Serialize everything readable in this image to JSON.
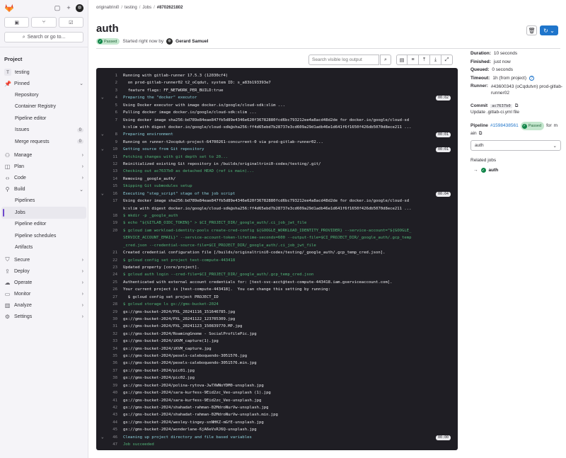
{
  "sidebar": {
    "search_label": "Search or go to...",
    "section_label": "Project",
    "project": {
      "initial": "T",
      "name": "testing"
    },
    "pinned_label": "Pinned",
    "pinned_items": [
      {
        "label": "Repository"
      },
      {
        "label": "Container Registry"
      },
      {
        "label": "Pipeline editor"
      },
      {
        "label": "Issues",
        "count": "0"
      },
      {
        "label": "Merge requests",
        "count": "0"
      }
    ],
    "groups_top": [
      {
        "label": "Manage",
        "icon": "users-icon"
      },
      {
        "label": "Plan",
        "icon": "plan-icon"
      },
      {
        "label": "Code",
        "icon": "code-icon"
      }
    ],
    "build_label": "Build",
    "build_items": [
      {
        "label": "Pipelines"
      },
      {
        "label": "Jobs",
        "active": true
      },
      {
        "label": "Pipeline editor"
      },
      {
        "label": "Pipeline schedules"
      },
      {
        "label": "Artifacts"
      }
    ],
    "groups_bottom": [
      {
        "label": "Secure",
        "icon": "shield-icon"
      },
      {
        "label": "Deploy",
        "icon": "deploy-icon"
      },
      {
        "label": "Operate",
        "icon": "operate-icon"
      },
      {
        "label": "Monitor",
        "icon": "monitor-icon"
      },
      {
        "label": "Analyze",
        "icon": "chart-icon"
      },
      {
        "label": "Settings",
        "icon": "gear-icon"
      }
    ]
  },
  "breadcrumb": [
    "originaltrini0",
    "testing",
    "Jobs",
    "#8702621802"
  ],
  "page": {
    "title": "auth",
    "status": "Passed",
    "started_text": "Started right now by",
    "user": "Gerard Samuel"
  },
  "log_toolbar": {
    "search_placeholder": "Search visible log output"
  },
  "log": [
    {
      "n": "1",
      "text": "Running with gitlab-runner 17.5.3 (12030cf4)",
      "c": "white"
    },
    {
      "n": "2",
      "text": "  on prod-gitlab-runner02 t2_oCqdut, system ID: s_a83b193393e7",
      "c": "white"
    },
    {
      "n": "3",
      "text": "  feature flags: FF_NETWORK_PER_BUILD:true",
      "c": "white"
    },
    {
      "n": "4",
      "text": "Preparing the \"docker\" executor",
      "c": "cyan",
      "caret": true,
      "dur": "00:02"
    },
    {
      "n": "5",
      "text": "Using Docker executor with image docker.io/google/cloud-sdk:slim ...",
      "c": "white"
    },
    {
      "n": "6",
      "text": "Pulling docker image docker.io/google/cloud-sdk:slim ...",
      "c": "white"
    },
    {
      "n": "7",
      "text": "Using docker image sha256:bd789e84eae847fb5d89e4346e620f36782880fcd6bc793212ee4a8acd48d2de for docker.io/google/cloud-sd",
      "c": "white"
    },
    {
      "n": "",
      "text": "k:slim with digest docker.io/google/cloud-sdk@sha256:ff4d65ebd7b28737e3cd609a29d1adb46e1d641f6f1650f426db5070d8ece211 ...",
      "c": "white"
    },
    {
      "n": "8",
      "text": "Preparing environment",
      "c": "cyan",
      "caret": true,
      "dur": "00:01"
    },
    {
      "n": "9",
      "text": "Running on runner-t2ocqdut-project-64700261-concurrent-0 via prod-gitlab-runner02...",
      "c": "white"
    },
    {
      "n": "10",
      "text": "Getting source from Git repository",
      "c": "cyan",
      "caret": true,
      "dur": "00:01"
    },
    {
      "n": "11",
      "text": "Fetching changes with git depth set to 20...",
      "c": "green"
    },
    {
      "n": "12",
      "text": "Reinitialized existing Git repository in /builds/originaltrini0-codes/testing/.git/",
      "c": "white"
    },
    {
      "n": "13",
      "text": "Checking out ac7637b0 as detached HEAD (ref is main)...",
      "c": "green"
    },
    {
      "n": "14",
      "text": "Removing _google_auth/",
      "c": "white"
    },
    {
      "n": "15",
      "text": "Skipping Git submodules setup",
      "c": "green"
    },
    {
      "n": "16",
      "text": "Executing \"step_script\" stage of the job script",
      "c": "cyan",
      "caret": true,
      "dur": "00:04"
    },
    {
      "n": "17",
      "text": "Using docker image sha256:bd789e84eae847fb5d89e4346e620f36782880fcd6bc793212ee4a8acd48d2de for docker.io/google/cloud-sd",
      "c": "white"
    },
    {
      "n": "",
      "text": "k:slim with digest docker.io/google/cloud-sdk@sha256:ff4d65ebd7b28737e3cd609a29d1adb46e1d641f6f1650f426db5070d8ece211 ...",
      "c": "white"
    },
    {
      "n": "18",
      "text": "$ mkdir -p _google_auth",
      "c": "green"
    },
    {
      "n": "19",
      "text": "$ echo \"${GITLAB_OIDC_TOKEN}\" > $CI_PROJECT_DIR/_google_auth/.ci_job_jwt_file",
      "c": "green"
    },
    {
      "n": "20",
      "text": "$ gcloud iam workload-identity-pools create-cred-config ${GOOGLE_WORKLOAD_IDENTITY_PROVIDER} --service-account=\"${GOOGLE_",
      "c": "green"
    },
    {
      "n": "",
      "text": "SERVICE_ACCOUNT_EMAIL}\" --service-account-token-lifetime-seconds=600 --output-file=$CI_PROJECT_DIR/_google_auth/.gcp_temp",
      "c": "green"
    },
    {
      "n": "",
      "text": "_cred.json --credential-source-file=$CI_PROJECT_DIR/_google_auth/.ci_job_jwt_file",
      "c": "green"
    },
    {
      "n": "21",
      "text": "Created credential configuration file [/builds/originaltrini0-codes/testing/_google_auth/.gcp_temp_cred.json].",
      "c": "white"
    },
    {
      "n": "22",
      "text": "$ gcloud config set project test-compute-443418",
      "c": "green"
    },
    {
      "n": "23",
      "text": "Updated property [core/project].",
      "c": "white"
    },
    {
      "n": "24",
      "text": "$ gcloud auth login --cred-file=$CI_PROJECT_DIR/_google_auth/.gcp_temp_cred.json",
      "c": "green"
    },
    {
      "n": "25",
      "text": "Authenticated with external account credentials for: [test-svc-acct@test-compute-443418.iam.gserviceaccount.com].",
      "c": "white"
    },
    {
      "n": "26",
      "text": "Your current project is [test-compute-443418].  You can change this setting by running:",
      "c": "white"
    },
    {
      "n": "27",
      "text": "  $ gcloud config set project PROJECT_ID",
      "c": "white"
    },
    {
      "n": "28",
      "text": "$ gcloud storage ls gs://gms-bucket-2024",
      "c": "green"
    },
    {
      "n": "29",
      "text": "gs://gms-bucket-2024/PXL_20241116_151646785.jpg",
      "c": "white"
    },
    {
      "n": "30",
      "text": "gs://gms-bucket-2024/PXL_20241122_123705309.jpg",
      "c": "white"
    },
    {
      "n": "31",
      "text": "gs://gms-bucket-2024/PXL_20241123_150839770.MP.jpg",
      "c": "white"
    },
    {
      "n": "32",
      "text": "gs://gms-bucket-2024/RoamingGnome - SocialProfilePic.jpg",
      "c": "white"
    },
    {
      "n": "33",
      "text": "gs://gms-bucket-2024/iKVM_capture(1).jpg",
      "c": "white"
    },
    {
      "n": "34",
      "text": "gs://gms-bucket-2024/iKVM_capture.jpg",
      "c": "white"
    },
    {
      "n": "35",
      "text": "gs://gms-bucket-2024/pexels-caleboquendo-3051576.jpg",
      "c": "white"
    },
    {
      "n": "36",
      "text": "gs://gms-bucket-2024/pexels-caleboquendo-3051576.min.jpg",
      "c": "white"
    },
    {
      "n": "37",
      "text": "gs://gms-bucket-2024/pic01.jpg",
      "c": "white"
    },
    {
      "n": "38",
      "text": "gs://gms-bucket-2024/pic02.jpg",
      "c": "white"
    },
    {
      "n": "39",
      "text": "gs://gms-bucket-2024/polina-rytova-Jw7XWNoYDM0-unsplash.jpg",
      "c": "white"
    },
    {
      "n": "40",
      "text": "gs://gms-bucket-2024/sara-kurfess-9Eid2zc_Veo-unsplash (1).jpg",
      "c": "white"
    },
    {
      "n": "41",
      "text": "gs://gms-bucket-2024/sara-kurfess-9Eid2zc_Veo-unsplash.jpg",
      "c": "white"
    },
    {
      "n": "42",
      "text": "gs://gms-bucket-2024/shahadat-rahman-02MdroNurVw-unsplash.jpg",
      "c": "white"
    },
    {
      "n": "43",
      "text": "gs://gms-bucket-2024/shahadat-rahman-02MdroNurVw-unsplash.min.jpg",
      "c": "white"
    },
    {
      "n": "44",
      "text": "gs://gms-bucket-2024/wesley-tingey-snNHKZ-mGfE-unsplash.jpg",
      "c": "white"
    },
    {
      "n": "45",
      "text": "gs://gms-bucket-2024/wonderlane-6jA6eVsRJ6Q-unsplash.jpg",
      "c": "white"
    },
    {
      "n": "46",
      "text": "Cleaning up project directory and file based variables",
      "c": "cyan",
      "caret": true,
      "dur": "00:00"
    },
    {
      "n": "47",
      "text": "Job succeeded",
      "c": "green"
    }
  ],
  "details": {
    "duration_label": "Duration:",
    "duration": "10 seconds",
    "finished_label": "Finished:",
    "finished": "just now",
    "queued_label": "Queued:",
    "queued": "0 seconds",
    "timeout_label": "Timeout:",
    "timeout": "1h (from project)",
    "runner_label": "Runner:",
    "runner": "#43600343 (oCqdutvn) prod-gitlab-runner02",
    "commit_label": "Commit",
    "commit_sha": "ac7637b0",
    "commit_message": "Update .gitlab-ci.yml file",
    "pipeline_label": "Pipeline",
    "pipeline_id": "#1598438561",
    "pipeline_status": "Passed",
    "pipeline_for": "for",
    "pipeline_ref_1": "m",
    "pipeline_ref_2": "ain",
    "stage_value": "auth",
    "related_label": "Related jobs",
    "related_job": "auth"
  }
}
